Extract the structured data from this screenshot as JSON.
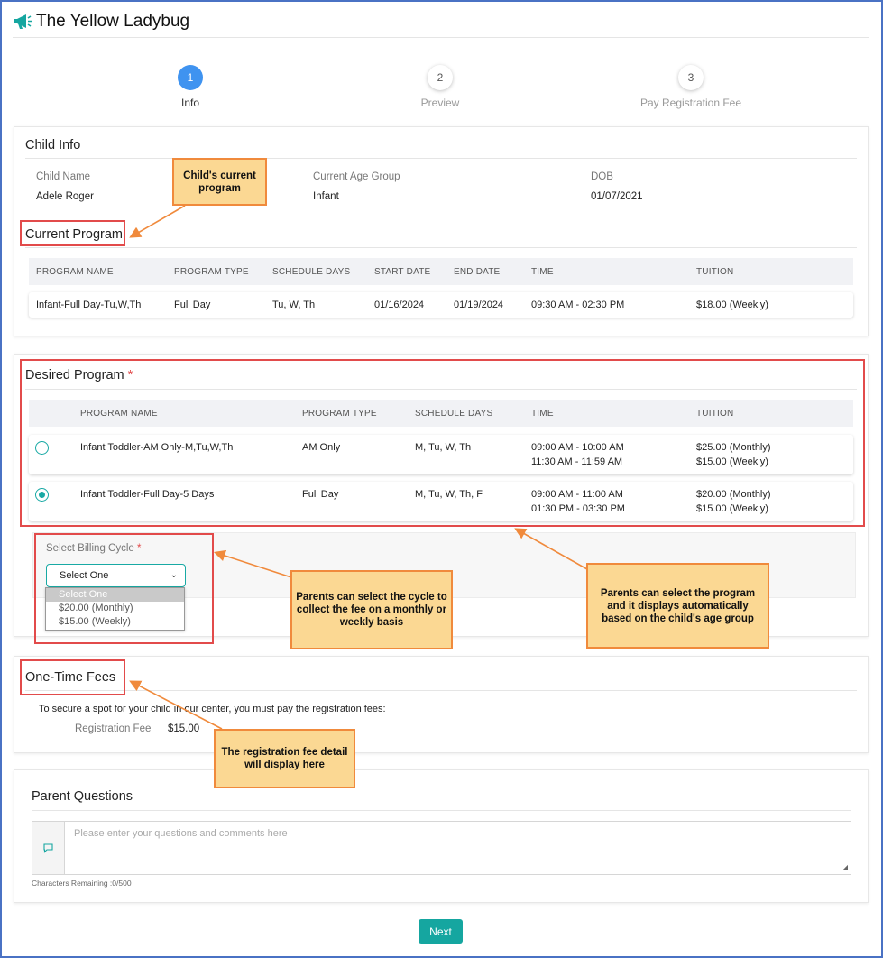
{
  "app": {
    "title": "The Yellow Ladybug"
  },
  "stepper": [
    {
      "number": "1",
      "label": "Info"
    },
    {
      "number": "2",
      "label": "Preview"
    },
    {
      "number": "3",
      "label": "Pay Registration Fee"
    }
  ],
  "child_info": {
    "section_title": "Child Info",
    "name_label": "Child Name",
    "name": "Adele Roger",
    "age_group_label": "Current Age Group",
    "age_group": "Infant",
    "dob_label": "DOB",
    "dob": "01/07/2021"
  },
  "current_program": {
    "section_title": "Current Program",
    "headers": [
      "PROGRAM NAME",
      "PROGRAM TYPE",
      "SCHEDULE DAYS",
      "START DATE",
      "END DATE",
      "TIME",
      "TUITION"
    ],
    "row": [
      "Infant-Full Day-Tu,W,Th",
      "Full Day",
      "Tu, W, Th",
      "01/16/2024",
      "01/19/2024",
      "09:30 AM - 02:30 PM",
      "$18.00 (Weekly)"
    ]
  },
  "desired_program": {
    "section_title": "Desired Program",
    "required_mark": "*",
    "headers": [
      "PROGRAM NAME",
      "PROGRAM TYPE",
      "SCHEDULE DAYS",
      "TIME",
      "TUITION"
    ],
    "rows": [
      {
        "name": "Infant Toddler-AM Only-M,Tu,W,Th",
        "type": "AM Only",
        "days": "M, Tu, W, Th",
        "time1": "09:00 AM - 10:00 AM",
        "time2": "11:30 AM - 11:59 AM",
        "tuition1": "$25.00 (Monthly)",
        "tuition2": "$15.00 (Weekly)",
        "selected": false
      },
      {
        "name": "Infant Toddler-Full Day-5 Days",
        "type": "Full Day",
        "days": "M, Tu, W, Th, F",
        "time1": "09:00 AM - 11:00 AM",
        "time2": "01:30 PM - 03:30 PM",
        "tuition1": "$20.00 (Monthly)",
        "tuition2": "$15.00 (Weekly)",
        "selected": true
      }
    ]
  },
  "billing": {
    "label": "Select Billing Cycle",
    "required_mark": "*",
    "selected": "Select One",
    "options": [
      "Select One",
      "$20.00 (Monthly)",
      "$15.00 (Weekly)"
    ]
  },
  "fees": {
    "section_title": "One-Time Fees",
    "description": "To secure a spot for your child in our center, you must pay the registration fees:",
    "fee_label": "Registration Fee",
    "fee_value": "$15.00"
  },
  "questions": {
    "section_title": "Parent Questions",
    "placeholder": "Please enter your questions and comments here",
    "chars_remaining": "Characters Remaining :0/500"
  },
  "annotations": {
    "current_program": "Child's current program",
    "billing": "Parents can select the cycle to collect the fee on a monthly or weekly basis",
    "desired": "Parents can select the program and it displays automatically based on the child's age group",
    "fee": "The registration fee detail will display here"
  },
  "actions": {
    "next_label": "Next"
  },
  "colors": {
    "accent": "#15a6a0",
    "step_active": "#3f93f0",
    "callout_fill": "#fbd893",
    "callout_border": "#f08a3c",
    "highlight_box": "#e24b4b"
  }
}
